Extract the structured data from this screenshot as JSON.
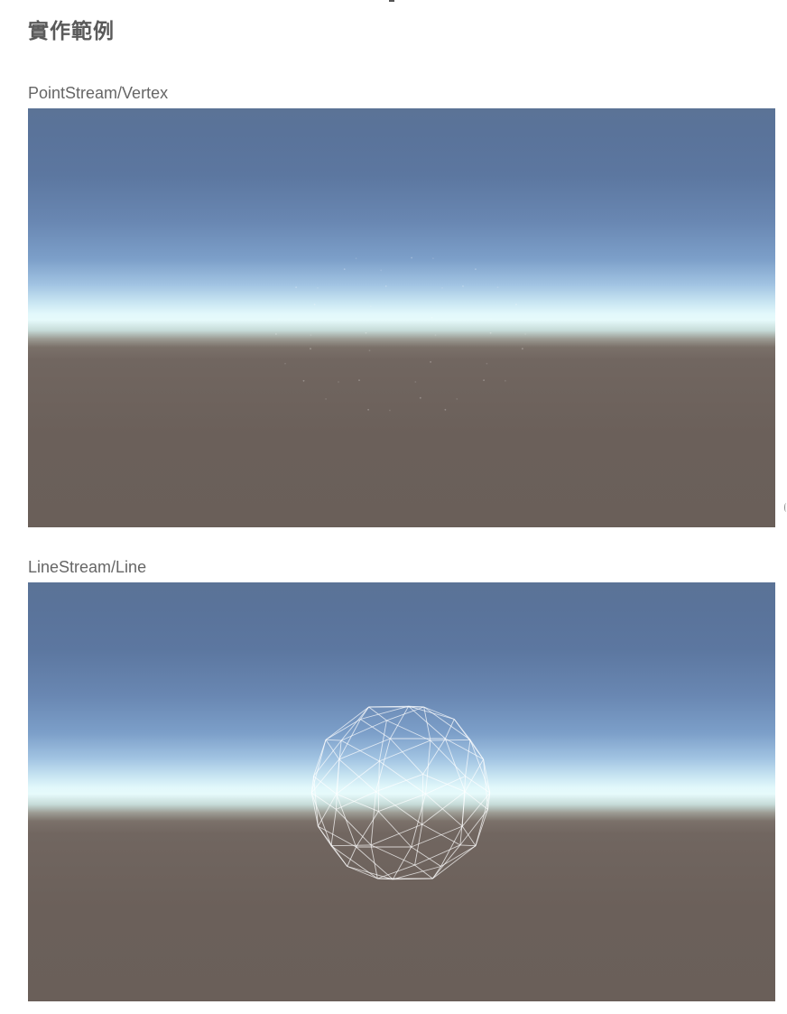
{
  "heading": "實作範例",
  "examples": [
    {
      "caption": "PointStream/Vertex",
      "mode": "points"
    },
    {
      "caption": "LineStream/Line",
      "mode": "wireframe"
    }
  ],
  "colors": {
    "sky_top": "#5b7396",
    "horizon": "#e6fafb",
    "ground": "#6a5f59",
    "wire": "#ffffff"
  }
}
